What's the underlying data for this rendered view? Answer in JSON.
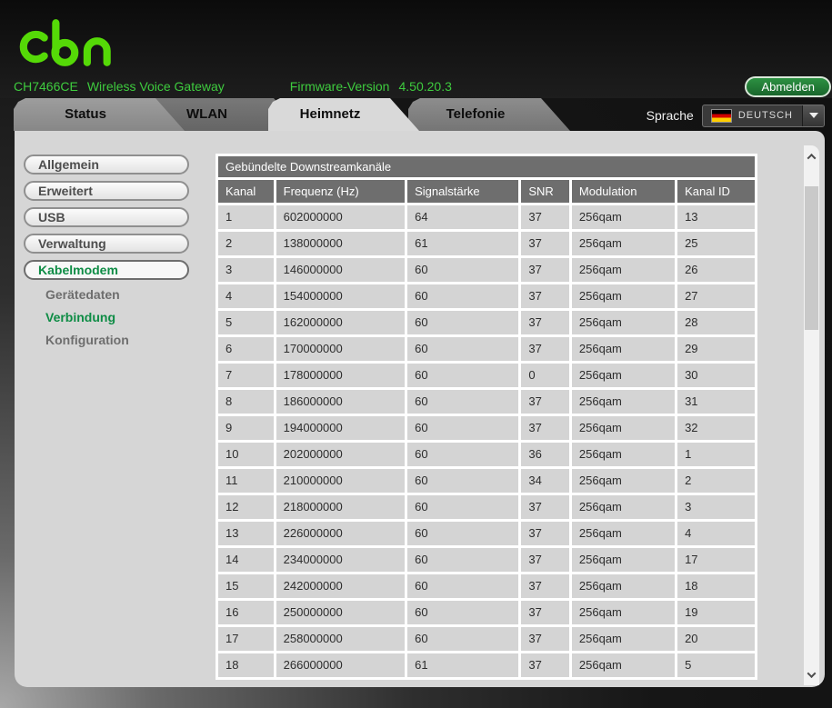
{
  "header": {
    "logo_text": "cbn",
    "model_id": "CH7466CE",
    "model_name": "Wireless Voice Gateway",
    "firmware_label": "Firmware-Version",
    "firmware_version": "4.50.20.3",
    "logout_label": "Abmelden"
  },
  "tabs": [
    {
      "label": "Status",
      "active": false
    },
    {
      "label": "WLAN",
      "active": false
    },
    {
      "label": "Heimnetz",
      "active": true
    },
    {
      "label": "Telefonie",
      "active": false
    }
  ],
  "language": {
    "label": "Sprache",
    "selected": "DEUTSCH",
    "flag_icon": "german-flag"
  },
  "sidebar": {
    "sections": [
      {
        "label": "Allgemein",
        "active": false
      },
      {
        "label": "Erweitert",
        "active": false
      },
      {
        "label": "USB",
        "active": false
      },
      {
        "label": "Verwaltung",
        "active": false
      },
      {
        "label": "Kabelmodem",
        "active": true
      }
    ],
    "subitems": [
      {
        "label": "Gerätedaten",
        "active": false
      },
      {
        "label": "Verbindung",
        "active": true
      },
      {
        "label": "Konfiguration",
        "active": false
      }
    ]
  },
  "table": {
    "title": "Gebündelte Downstreamkanäle",
    "columns": [
      "Kanal",
      "Frequenz (Hz)",
      "Signalstärke",
      "SNR",
      "Modulation",
      "Kanal ID"
    ],
    "rows": [
      [
        "1",
        "602000000",
        "64",
        "37",
        "256qam",
        "13"
      ],
      [
        "2",
        "138000000",
        "61",
        "37",
        "256qam",
        "25"
      ],
      [
        "3",
        "146000000",
        "60",
        "37",
        "256qam",
        "26"
      ],
      [
        "4",
        "154000000",
        "60",
        "37",
        "256qam",
        "27"
      ],
      [
        "5",
        "162000000",
        "60",
        "37",
        "256qam",
        "28"
      ],
      [
        "6",
        "170000000",
        "60",
        "37",
        "256qam",
        "29"
      ],
      [
        "7",
        "178000000",
        "60",
        "0",
        "256qam",
        "30"
      ],
      [
        "8",
        "186000000",
        "60",
        "37",
        "256qam",
        "31"
      ],
      [
        "9",
        "194000000",
        "60",
        "37",
        "256qam",
        "32"
      ],
      [
        "10",
        "202000000",
        "60",
        "36",
        "256qam",
        "1"
      ],
      [
        "11",
        "210000000",
        "60",
        "34",
        "256qam",
        "2"
      ],
      [
        "12",
        "218000000",
        "60",
        "37",
        "256qam",
        "3"
      ],
      [
        "13",
        "226000000",
        "60",
        "37",
        "256qam",
        "4"
      ],
      [
        "14",
        "234000000",
        "60",
        "37",
        "256qam",
        "17"
      ],
      [
        "15",
        "242000000",
        "60",
        "37",
        "256qam",
        "18"
      ],
      [
        "16",
        "250000000",
        "60",
        "37",
        "256qam",
        "19"
      ],
      [
        "17",
        "258000000",
        "60",
        "37",
        "256qam",
        "20"
      ],
      [
        "18",
        "266000000",
        "61",
        "37",
        "256qam",
        "5"
      ]
    ]
  },
  "colors": {
    "logo_green": "#55d907",
    "header_text_green": "#3ecb3e",
    "sidebar_active_green": "#0e8c45",
    "logout_button_green": "#237a36",
    "table_header_gray": "#6e6e6e",
    "table_row_gray": "#d4d4d4",
    "panel_gray": "#d6d6d6"
  }
}
